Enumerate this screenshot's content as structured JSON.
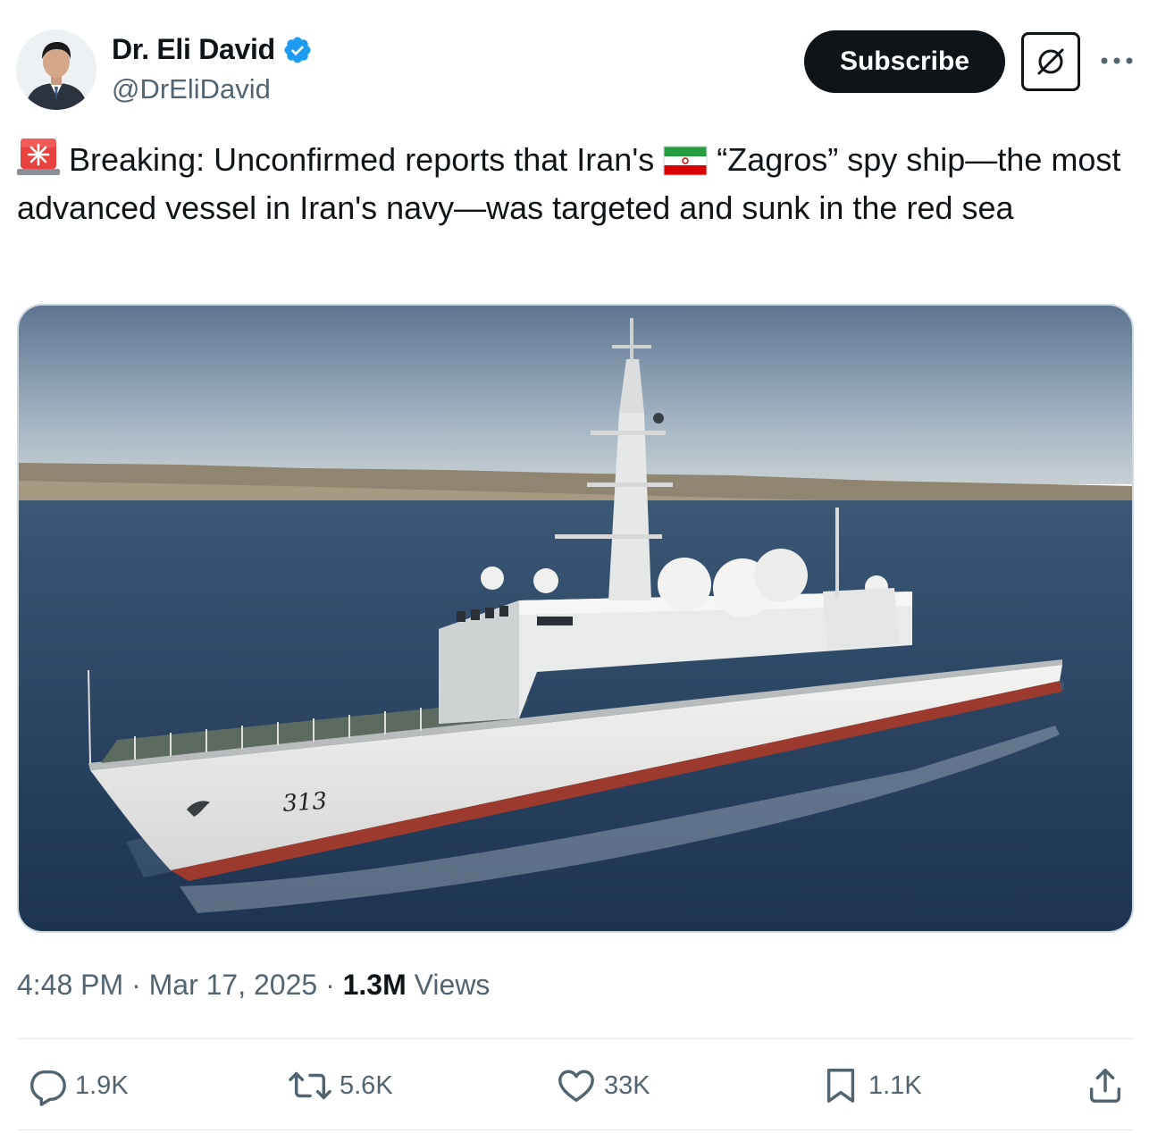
{
  "author": {
    "name": "Dr. Eli David",
    "handle": "@DrEliDavid",
    "verified_icon": "verified-badge-icon"
  },
  "header": {
    "subscribe_label": "Subscribe",
    "grok_icon": "grok-icon",
    "more_icon": "more-icon"
  },
  "tweet": {
    "text_part1": "Breaking: Unconfirmed reports that Iran's",
    "text_part2": "“Zagros” spy ship—the most advanced vessel in Iran's navy—was targeted and sunk in the red sea",
    "siren_emoji": "rotating-light-icon",
    "flag_emoji": "iran-flag-icon"
  },
  "media": {
    "hull_number": "313"
  },
  "meta": {
    "time": "4:48 PM",
    "sep1": "·",
    "date": "Mar 17, 2025",
    "sep2": "·",
    "views_count": "1.3M",
    "views_label": "Views"
  },
  "actions": {
    "replies": "1.9K",
    "reposts": "5.6K",
    "likes": "33K",
    "bookmarks": "1.1K"
  },
  "colors": {
    "text_primary": "#0f1419",
    "text_secondary": "#536471",
    "verified_blue": "#1d9bf0",
    "border": "#cfd9de"
  }
}
